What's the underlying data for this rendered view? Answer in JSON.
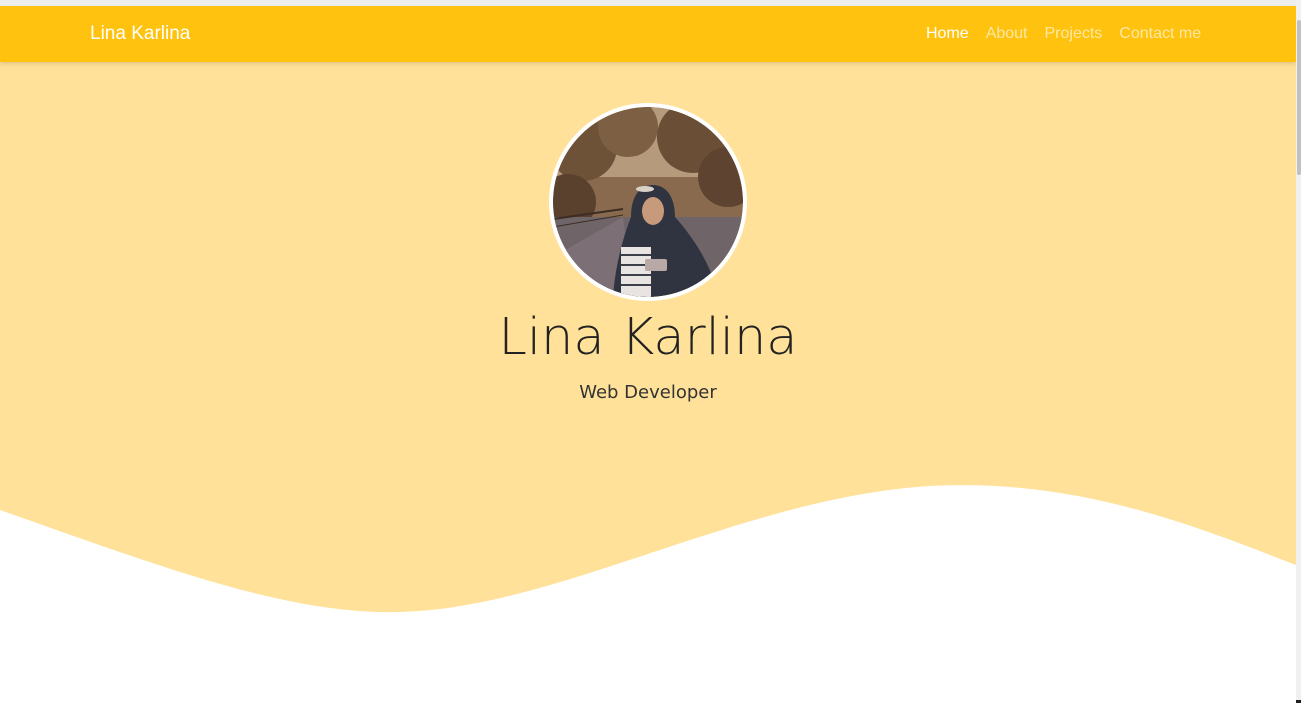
{
  "navbar": {
    "brand": "Lina Karlina",
    "links": [
      {
        "label": "Home",
        "active": true
      },
      {
        "label": "About",
        "active": false
      },
      {
        "label": "Projects",
        "active": false
      },
      {
        "label": "Contact me",
        "active": false
      }
    ]
  },
  "hero": {
    "name": "Lina Karlina",
    "subtitle": "Web Developer"
  },
  "colors": {
    "navbar_bg": "#ffc20e",
    "hero_bg": "#ffe199",
    "text_dark": "#222222",
    "link_active": "#ffffff"
  }
}
